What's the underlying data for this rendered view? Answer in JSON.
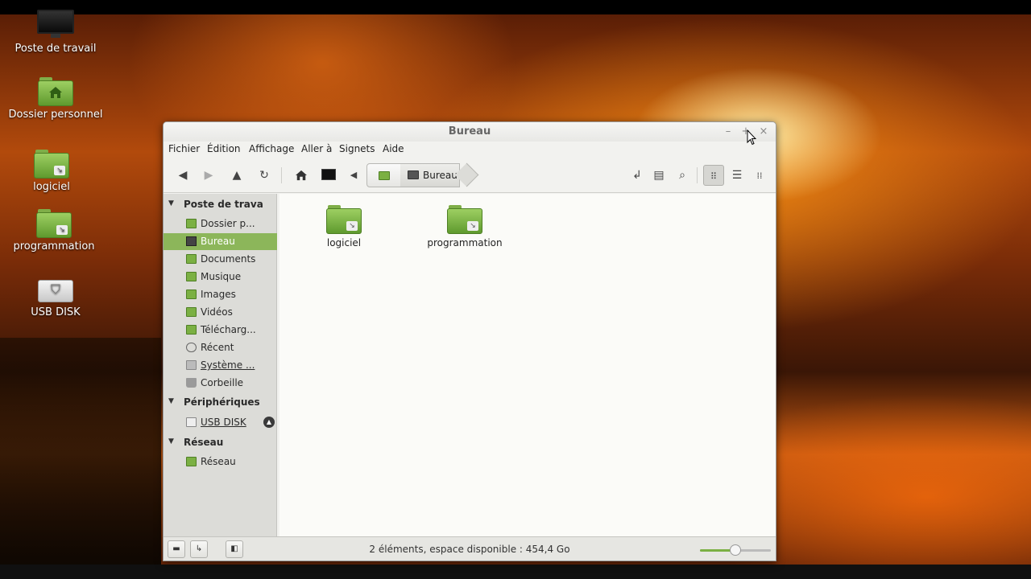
{
  "desktop": {
    "icons": [
      {
        "label": "Poste de travail",
        "icon": "computer-icon"
      },
      {
        "label": "Dossier personnel",
        "icon": "home-folder-icon"
      },
      {
        "label": "logiciel",
        "icon": "folder-link-icon"
      },
      {
        "label": "programmation",
        "icon": "folder-link-icon"
      },
      {
        "label": "USB DISK",
        "icon": "usb-drive-icon"
      }
    ]
  },
  "window": {
    "title": "Bureau",
    "controls": {
      "minimize": "–",
      "maximize": "+",
      "close": "×"
    }
  },
  "menubar": [
    "Fichier",
    "Édition",
    "Affichage",
    "Aller à",
    "Signets",
    "Aide"
  ],
  "toolbar": {
    "back": "back-icon",
    "forward": "forward-icon",
    "up": "up-icon",
    "reload": "reload-icon",
    "home": "home-icon",
    "computer": "computer-icon",
    "path_toggle": "left-arrow-icon",
    "path_current": "Bureau",
    "open_terminal": "terminal-icon",
    "new_folder": "new-folder-icon",
    "search": "search-icon",
    "view_icons": "icon-view-icon",
    "view_list": "list-view-icon",
    "view_compact": "compact-view-icon"
  },
  "sidebar": {
    "sections": [
      {
        "title": "Poste de trava",
        "items": [
          {
            "label": "Dossier p...",
            "icon": "folder-icon"
          },
          {
            "label": "Bureau",
            "icon": "desktop-icon",
            "selected": true
          },
          {
            "label": "Documents",
            "icon": "folder-icon"
          },
          {
            "label": "Musique",
            "icon": "folder-icon"
          },
          {
            "label": "Images",
            "icon": "folder-icon"
          },
          {
            "label": "Vidéos",
            "icon": "folder-icon"
          },
          {
            "label": "Télécharg...",
            "icon": "folder-icon"
          },
          {
            "label": "Récent",
            "icon": "recent-icon"
          },
          {
            "label": "Système ...",
            "icon": "drive-icon"
          },
          {
            "label": "Corbeille",
            "icon": "trash-icon"
          }
        ]
      },
      {
        "title": "Périphériques",
        "items": [
          {
            "label": "USB DISK",
            "icon": "drive-icon",
            "eject": true
          }
        ]
      },
      {
        "title": "Réseau",
        "items": [
          {
            "label": "Réseau",
            "icon": "network-icon"
          }
        ]
      }
    ]
  },
  "content": {
    "files": [
      {
        "name": "logiciel",
        "icon": "folder-link-icon"
      },
      {
        "name": "programmation",
        "icon": "folder-link-icon"
      }
    ]
  },
  "statusbar": {
    "text": "2 éléments, espace disponible : 454,4 Go",
    "zoom_fraction": 0.5
  }
}
